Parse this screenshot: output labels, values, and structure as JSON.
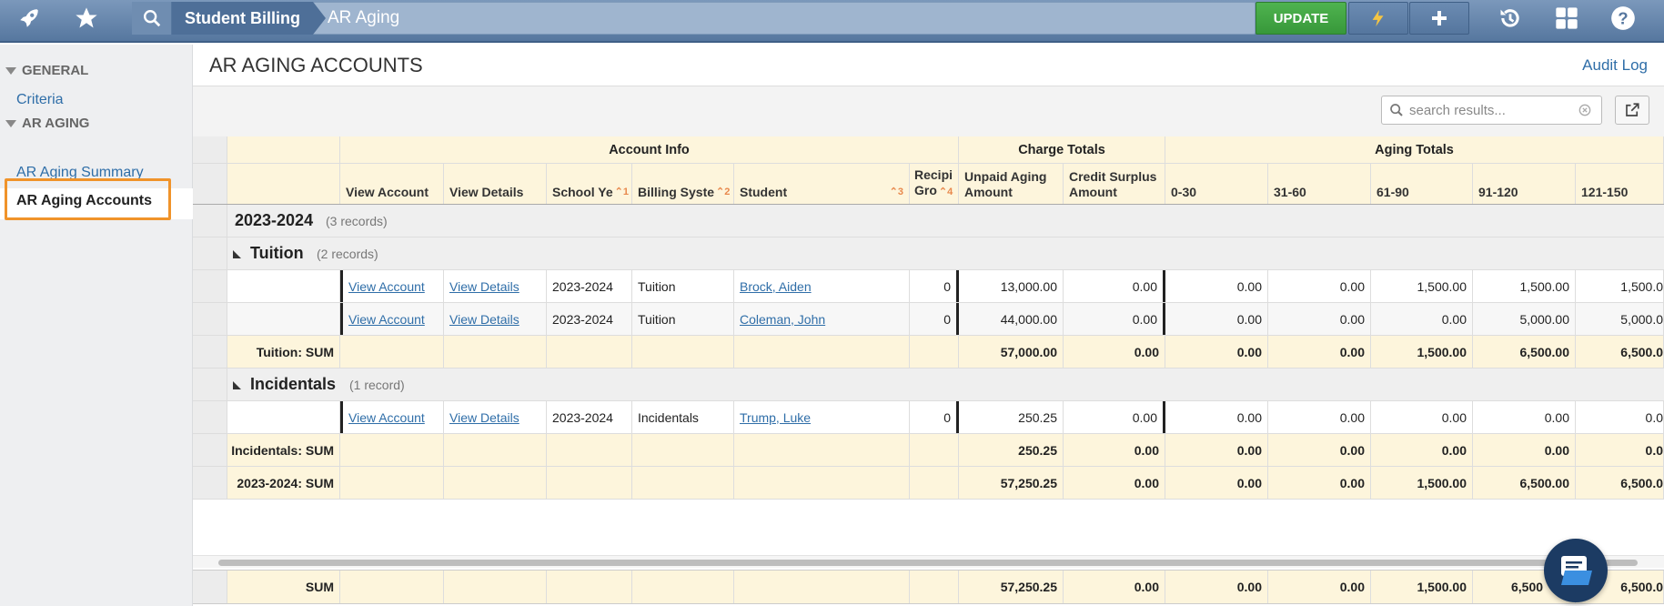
{
  "topbar": {
    "breadcrumb": [
      "Student Billing",
      "AR Aging"
    ],
    "update_label": "UPDATE",
    "icons": [
      "rocket-icon",
      "star-icon",
      "search-icon",
      "bolt-icon",
      "plus-icon",
      "history-icon",
      "grid-icon",
      "help-icon"
    ]
  },
  "sidebar": {
    "sections": [
      {
        "label": "GENERAL",
        "items": [
          "Criteria"
        ]
      },
      {
        "label": "AR AGING",
        "items": [
          "AR Aging Summary",
          "AR Aging Accounts"
        ]
      }
    ]
  },
  "main": {
    "title": "AR AGING ACCOUNTS",
    "audit_log": "Audit Log",
    "search_placeholder": "search results..."
  },
  "grid": {
    "group_headers": [
      "Account Info",
      "Charge Totals",
      "Aging Totals"
    ],
    "columns": [
      "View Account",
      "View Details",
      "School Ye",
      "Billing Syste",
      "Student",
      "Recipi Gro",
      "Unpaid Aging Amount",
      "Credit Surplus Amount",
      "0-30",
      "31-60",
      "61-90",
      "91-120",
      "121-150"
    ],
    "col_recipient_1": "Recipi",
    "col_recipient_2": "Gro",
    "col_unpaid_1": "Unpaid Aging",
    "col_unpaid_2": "Amount",
    "col_credit_1": "Credit Surplus",
    "col_credit_2": "Amount",
    "sort_marks": [
      "1",
      "2",
      "3",
      "4"
    ],
    "year_group": {
      "label": "2023-2024",
      "count": "(3 records)"
    },
    "tuition_group": {
      "label": "Tuition",
      "count": "(2 records)"
    },
    "incidentals_group": {
      "label": "Incidentals",
      "count": "(1 record)"
    },
    "rows": {
      "tuition_1": {
        "view_account": "View Account",
        "view_details": "View Details",
        "school_year": "2023-2024",
        "billing_system": "Tuition",
        "student": "Brock, Aiden",
        "recipient": "0",
        "unpaid": "13,000.00",
        "credit": "0.00",
        "a0_30": "0.00",
        "a31_60": "0.00",
        "a61_90": "1,500.00",
        "a91_120": "1,500.00",
        "a121_150": "1,500.0"
      },
      "tuition_2": {
        "view_account": "View Account",
        "view_details": "View Details",
        "school_year": "2023-2024",
        "billing_system": "Tuition",
        "student": "Coleman, John",
        "recipient": "0",
        "unpaid": "44,000.00",
        "credit": "0.00",
        "a0_30": "0.00",
        "a31_60": "0.00",
        "a61_90": "0.00",
        "a91_120": "5,000.00",
        "a121_150": "5,000.0"
      },
      "tuition_sum": {
        "label": "Tuition: SUM",
        "unpaid": "57,000.00",
        "credit": "0.00",
        "a0_30": "0.00",
        "a31_60": "0.00",
        "a61_90": "1,500.00",
        "a91_120": "6,500.00",
        "a121_150": "6,500.0"
      },
      "incidentals_1": {
        "view_account": "View Account",
        "view_details": "View Details",
        "school_year": "2023-2024",
        "billing_system": "Incidentals",
        "student": "Trump, Luke",
        "recipient": "0",
        "unpaid": "250.25",
        "credit": "0.00",
        "a0_30": "0.00",
        "a31_60": "0.00",
        "a61_90": "0.00",
        "a91_120": "0.00",
        "a121_150": "0.0"
      },
      "incidentals_sum": {
        "label": "Incidentals: SUM",
        "unpaid": "250.25",
        "credit": "0.00",
        "a0_30": "0.00",
        "a31_60": "0.00",
        "a61_90": "0.00",
        "a91_120": "0.00",
        "a121_150": "0.0"
      },
      "year_sum": {
        "label": "2023-2024: SUM",
        "unpaid": "57,250.25",
        "credit": "0.00",
        "a0_30": "0.00",
        "a31_60": "0.00",
        "a61_90": "1,500.00",
        "a91_120": "6,500.00",
        "a121_150": "6,500.0"
      }
    },
    "total_sum": {
      "label": "SUM",
      "unpaid": "57,250.25",
      "credit": "0.00",
      "a0_30": "0.00",
      "a31_60": "0.00",
      "a61_90": "1,500.00",
      "a91_120": "6,500",
      "a121_150": "6,500.0"
    }
  }
}
